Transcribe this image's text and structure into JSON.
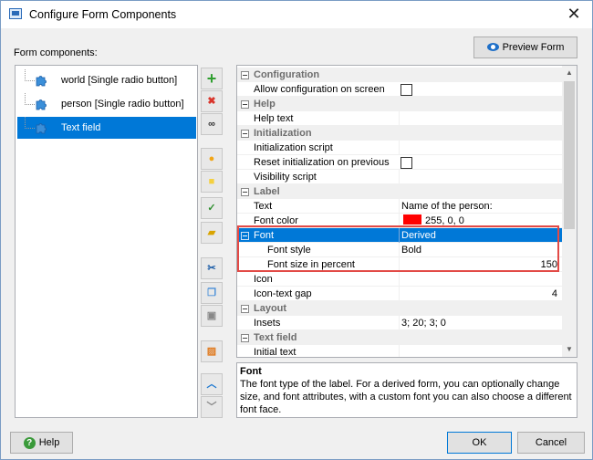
{
  "window": {
    "title": "Configure Form Components",
    "close_glyph": "✕"
  },
  "components_label": "Form components:",
  "preview_button": "Preview Form",
  "components": [
    {
      "label": "world [Single radio button]",
      "icon": "puzzle-icon"
    },
    {
      "label": "person [Single radio button]",
      "icon": "puzzle-icon"
    },
    {
      "label": "Text field",
      "icon": "puzzle-icon",
      "selected": true
    }
  ],
  "toolbar_icons": [
    "add-icon",
    "delete-icon",
    "find-icon",
    "comment-icon",
    "note-icon",
    "check-icon",
    "folder-icon",
    "cut-icon",
    "copy-icon",
    "paste-icon",
    "image-icon",
    "up-arrow-icon",
    "down-arrow-icon"
  ],
  "properties": [
    {
      "type": "cat",
      "name": "Configuration"
    },
    {
      "type": "prop",
      "name": "Allow configuration on screen",
      "checkbox": true
    },
    {
      "type": "cat",
      "name": "Help"
    },
    {
      "type": "prop",
      "name": "Help text",
      "value": ""
    },
    {
      "type": "cat",
      "name": "Initialization"
    },
    {
      "type": "prop",
      "name": "Initialization script",
      "value": ""
    },
    {
      "type": "prop",
      "name": "Reset initialization on previous",
      "checkbox": true
    },
    {
      "type": "prop",
      "name": "Visibility script",
      "value": ""
    },
    {
      "type": "cat",
      "name": "Label"
    },
    {
      "type": "prop",
      "name": "Text",
      "value": "Name of the person:"
    },
    {
      "type": "prop",
      "name": "Font color",
      "value": "255, 0, 0",
      "swatch": "#ff0000"
    },
    {
      "type": "prop",
      "name": "Font",
      "value": "Derived",
      "expandable": true,
      "selected": true
    },
    {
      "type": "prop",
      "name": "Font style",
      "value": "Bold",
      "sub": true
    },
    {
      "type": "prop",
      "name": "Font size in percent",
      "value": "150",
      "sub": true,
      "align": "right"
    },
    {
      "type": "prop",
      "name": "Icon",
      "value": ""
    },
    {
      "type": "prop",
      "name": "Icon-text gap",
      "value": "4",
      "align": "right"
    },
    {
      "type": "cat",
      "name": "Layout"
    },
    {
      "type": "prop",
      "name": "Insets",
      "value": "3; 20; 3; 0"
    },
    {
      "type": "cat",
      "name": "Text field"
    },
    {
      "type": "prop",
      "name": "Initial text",
      "value": ""
    }
  ],
  "description": {
    "title": "Font",
    "text": "The font type of the label. For a derived form, you can optionally change size, and font attributes, with a custom font you can also choose a different font face."
  },
  "buttons": {
    "help": "Help",
    "ok": "OK",
    "cancel": "Cancel"
  },
  "colors": {
    "selection": "#0078d7",
    "highlight_border": "#e24a46",
    "font_color_swatch": "#ff0000"
  }
}
